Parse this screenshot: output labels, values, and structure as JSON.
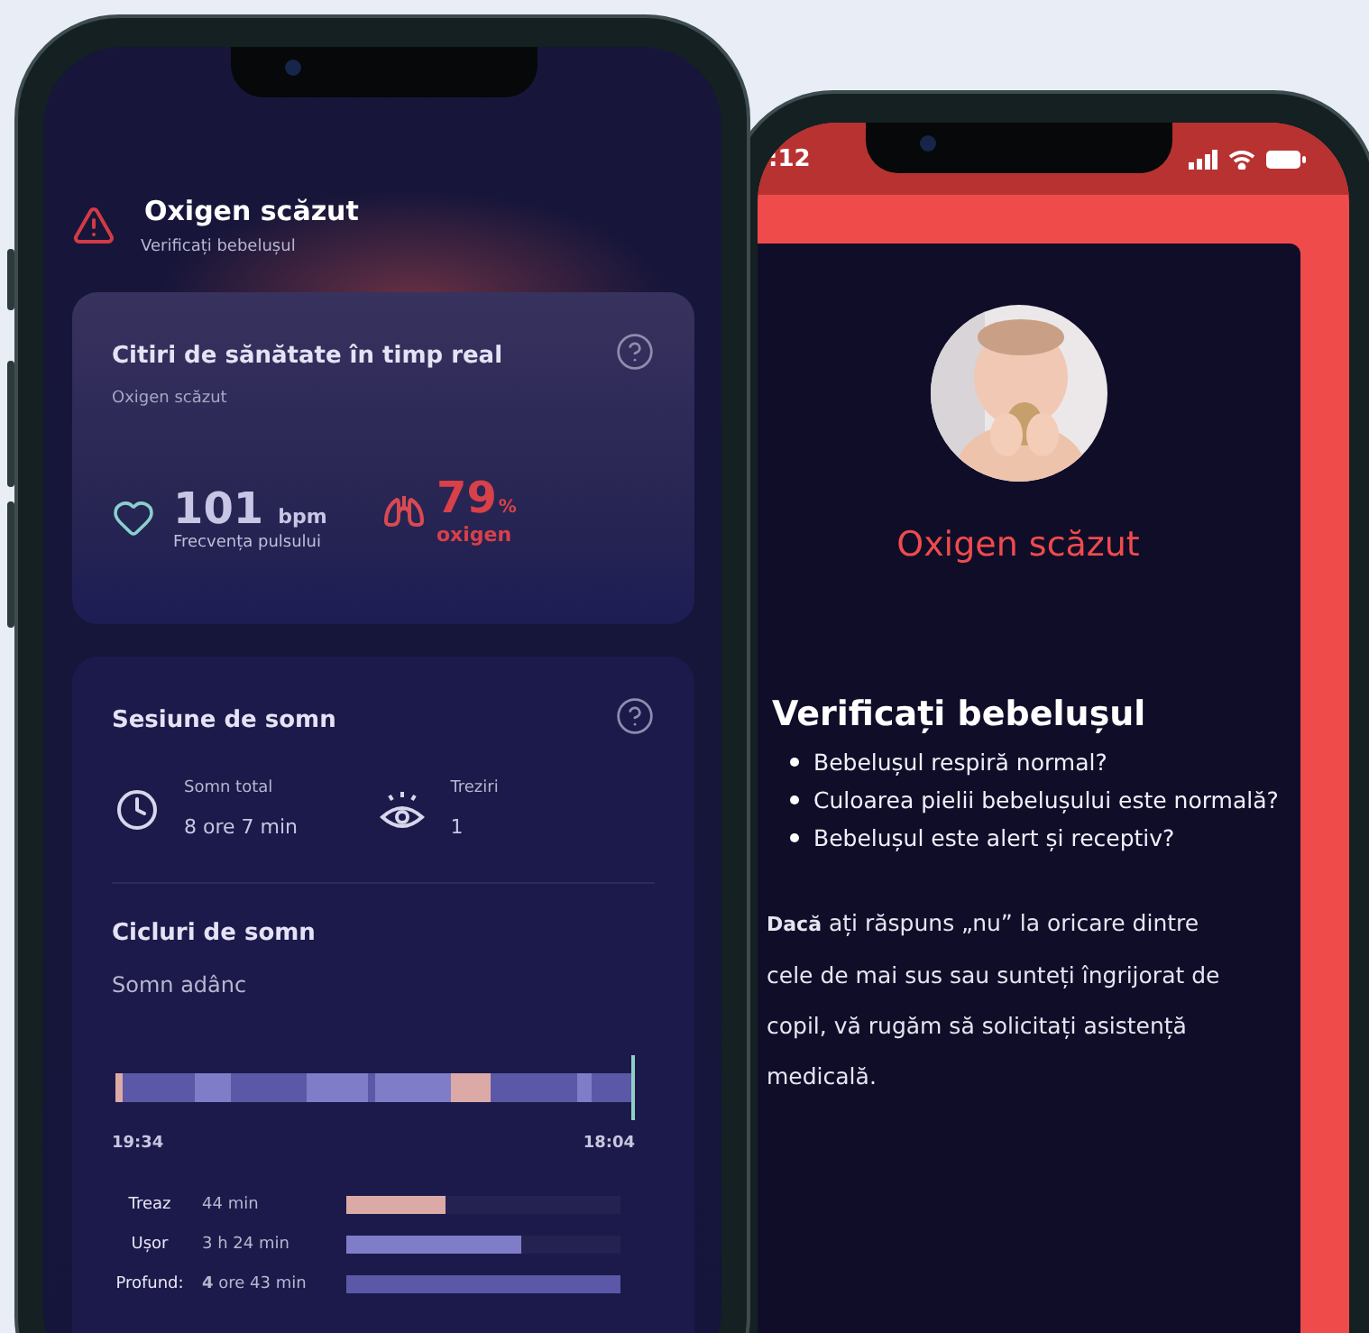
{
  "left_phone": {
    "alert": {
      "title": "Oxigen scăzut",
      "subtitle": "Verificați bebelușul"
    },
    "health_card": {
      "title": "Citiri de sănătate în timp real",
      "subtitle": "Oxigen scăzut",
      "heart_rate": {
        "value": "101",
        "unit": "bpm",
        "label": "Frecvența pulsului"
      },
      "oxygen": {
        "value": "79",
        "unit": "%",
        "label": "oxigen"
      }
    },
    "sleep_card": {
      "title": "Sesiune de somn",
      "stats": [
        {
          "kind": "clock",
          "label": "Somn total",
          "value": "8 ore 7 min"
        },
        {
          "kind": "eye",
          "label": "Treziri",
          "value": "1"
        }
      ],
      "cycles_title": "Cicluri de somn",
      "cycles_subtitle": "Somn adânc",
      "start_time": "19:34",
      "end_time": "18:04",
      "stages": [
        {
          "name": "Treaz",
          "duration": "44 min",
          "level": 0.36,
          "color": "#dcaaa6"
        },
        {
          "name": "Ușor",
          "duration": "3 h 24 min",
          "level": 0.64,
          "color": "#7f7cc8"
        },
        {
          "name": "Profund:",
          "duration": "**4** ore 43 min",
          "level": 1,
          "color": "#5b58a8"
        }
      ]
    }
  },
  "right_phone": {
    "status_time": ":12",
    "alert_title": "Oxigen scăzut",
    "heading": "Verificați bebelușul",
    "questions": [
      "Bebelușul respiră normal?",
      "Culoarea pielii bebelușului este normală?",
      "Bebelușul este alert și receptiv?"
    ],
    "advice": "**Dacă** ați răspuns „nu” la oricare dintre cele de mai sus sau sunteți îngrijorat de copil, vă rugăm să solicitați asistență medicală."
  }
}
